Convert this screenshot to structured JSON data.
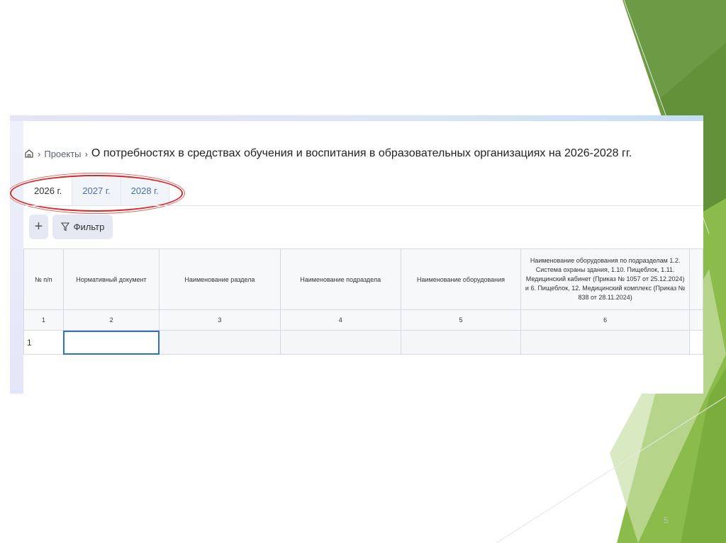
{
  "breadcrumb": {
    "home_icon": "home-icon",
    "projects": "Проекты",
    "title": "О потребностях в средствах обучения и воспитания в образовательных организациях на 2026-2028 гг."
  },
  "tabs": [
    {
      "label": "2026 г.",
      "active": true
    },
    {
      "label": "2027 г."
    },
    {
      "label": "2028 г."
    }
  ],
  "toolbar": {
    "add_icon": "plus-icon",
    "filter_label": "Фильтр",
    "filter_icon": "filter-icon"
  },
  "table": {
    "headers": [
      "№ п/п",
      "Нормативный документ",
      "Наименование раздела",
      "Наименование подраздела",
      "Наименование оборудования",
      "Наименование оборудования по подразделам 1.2. Система охраны здания, 1.10. Пищеблок, 1.11. Медицинский кабинет (Приказ № 1057 от 25.12.2024) и 6. Пищеблок, 12. Медицинский комплекс (Приказ № 838 от 28.11.2024)"
    ],
    "numbers": [
      "1",
      "2",
      "3",
      "4",
      "5",
      "6"
    ],
    "rows": [
      [
        "1",
        "",
        "",
        "",
        "",
        ""
      ]
    ]
  },
  "slide_number": "5",
  "colors": {
    "annotation": "#d62a2a",
    "accent_green": "#6a9a3a",
    "tab_text": "#4a6fa8"
  }
}
